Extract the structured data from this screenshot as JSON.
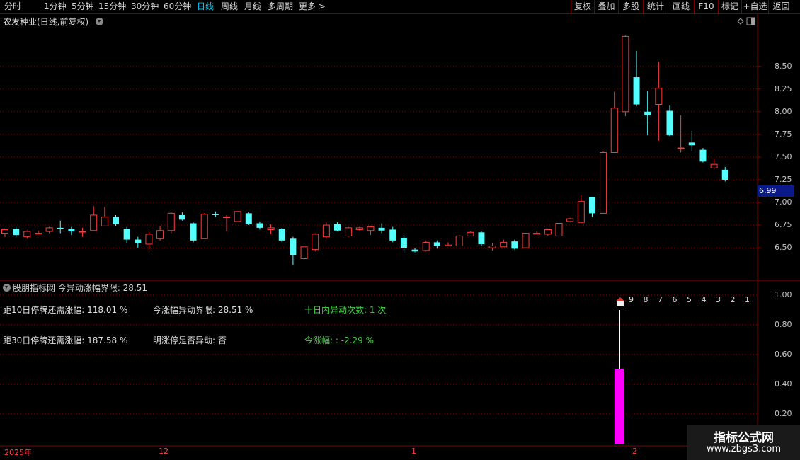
{
  "toolbar": {
    "periods": [
      "分时",
      "1分钟",
      "5分钟",
      "15分钟",
      "30分钟",
      "60分钟",
      "日线",
      "周线",
      "月线",
      "多周期",
      "更多 >"
    ],
    "active_period": "日线",
    "right_buttons": [
      "复权",
      "叠加",
      "多股",
      "统计",
      "画线",
      "F10",
      "标记",
      "+自选",
      "返回"
    ]
  },
  "main_panel": {
    "title": "农发种业(日线,前复权)",
    "current_price_badge": "6.99",
    "y_labels": [
      "8.50",
      "8.25",
      "8.00",
      "7.75",
      "7.50",
      "7.25",
      "7.00",
      "6.75",
      "6.50"
    ]
  },
  "indicator_panel": {
    "title": "股朋指标网 今异动涨幅界限: 28.51",
    "y_labels": [
      "1.00",
      "0.80",
      "0.60",
      "0.40",
      "0.20"
    ],
    "rows": [
      {
        "label": "距10日停牌还需涨幅:",
        "value": "118.01 %"
      },
      {
        "label": "今涨幅异动界限:",
        "value": "28.51 %"
      },
      {
        "label": "十日内异动次数:",
        "value": "1 次"
      },
      {
        "label": "距30日停牌还需涨幅:",
        "value": "187.58 %"
      },
      {
        "label": "明涨停是否异动:",
        "value": "否"
      },
      {
        "label": "今涨幅:",
        "value": ": -2.29 %"
      }
    ],
    "countdown": "9 8 7 6 5 4 3 2 1",
    "bar_value": 0.5,
    "line_top_value": 0.9
  },
  "date_axis": [
    "2025年",
    "12",
    "1",
    "2"
  ],
  "watermark": {
    "line1": "指标公式网",
    "line2": "www.zbgs3.com"
  },
  "colors": {
    "up": "#ff3c3c",
    "down": "#54ffff",
    "magenta": "#ff00ff",
    "grid": "#8a0000",
    "active": "#00c8ff"
  },
  "chart_data": {
    "type": "candlestick",
    "title": "农发种业(日线,前复权)",
    "ylim": [
      6.22,
      8.95
    ],
    "candles": [
      {
        "o": 6.66,
        "h": 6.71,
        "l": 6.62,
        "c": 6.7
      },
      {
        "o": 6.71,
        "h": 6.73,
        "l": 6.62,
        "c": 6.64
      },
      {
        "o": 6.62,
        "h": 6.69,
        "l": 6.6,
        "c": 6.68
      },
      {
        "o": 6.66,
        "h": 6.69,
        "l": 6.65,
        "c": 6.66
      },
      {
        "o": 6.68,
        "h": 6.73,
        "l": 6.66,
        "c": 6.72
      },
      {
        "o": 6.72,
        "h": 6.8,
        "l": 6.66,
        "c": 6.71
      },
      {
        "o": 6.71,
        "h": 6.73,
        "l": 6.64,
        "c": 6.68
      },
      {
        "o": 6.68,
        "h": 6.72,
        "l": 6.62,
        "c": 6.68
      },
      {
        "o": 6.69,
        "h": 6.96,
        "l": 6.69,
        "c": 6.86
      },
      {
        "o": 6.74,
        "h": 6.95,
        "l": 6.74,
        "c": 6.84
      },
      {
        "o": 6.84,
        "h": 6.86,
        "l": 6.74,
        "c": 6.76
      },
      {
        "o": 6.71,
        "h": 6.73,
        "l": 6.55,
        "c": 6.59
      },
      {
        "o": 6.59,
        "h": 6.62,
        "l": 6.5,
        "c": 6.55
      },
      {
        "o": 6.54,
        "h": 6.68,
        "l": 6.48,
        "c": 6.65
      },
      {
        "o": 6.6,
        "h": 6.74,
        "l": 6.58,
        "c": 6.69
      },
      {
        "o": 6.69,
        "h": 6.89,
        "l": 6.66,
        "c": 6.88
      },
      {
        "o": 6.86,
        "h": 6.89,
        "l": 6.8,
        "c": 6.81
      },
      {
        "o": 6.77,
        "h": 6.78,
        "l": 6.56,
        "c": 6.58
      },
      {
        "o": 6.6,
        "h": 6.88,
        "l": 6.6,
        "c": 6.87
      },
      {
        "o": 6.87,
        "h": 6.9,
        "l": 6.84,
        "c": 6.86
      },
      {
        "o": 6.84,
        "h": 6.86,
        "l": 6.68,
        "c": 6.84
      },
      {
        "o": 6.79,
        "h": 6.9,
        "l": 6.79,
        "c": 6.9
      },
      {
        "o": 6.88,
        "h": 6.89,
        "l": 6.75,
        "c": 6.76
      },
      {
        "o": 6.77,
        "h": 6.79,
        "l": 6.7,
        "c": 6.72
      },
      {
        "o": 6.7,
        "h": 6.76,
        "l": 6.65,
        "c": 6.72
      },
      {
        "o": 6.71,
        "h": 6.72,
        "l": 6.56,
        "c": 6.58
      },
      {
        "o": 6.6,
        "h": 6.62,
        "l": 6.31,
        "c": 6.42
      },
      {
        "o": 6.38,
        "h": 6.52,
        "l": 6.37,
        "c": 6.51
      },
      {
        "o": 6.48,
        "h": 6.66,
        "l": 6.46,
        "c": 6.65
      },
      {
        "o": 6.62,
        "h": 6.78,
        "l": 6.6,
        "c": 6.75
      },
      {
        "o": 6.76,
        "h": 6.78,
        "l": 6.68,
        "c": 6.69
      },
      {
        "o": 6.63,
        "h": 6.73,
        "l": 6.62,
        "c": 6.72
      },
      {
        "o": 6.7,
        "h": 6.73,
        "l": 6.69,
        "c": 6.72
      },
      {
        "o": 6.69,
        "h": 6.74,
        "l": 6.64,
        "c": 6.73
      },
      {
        "o": 6.72,
        "h": 6.77,
        "l": 6.66,
        "c": 6.69
      },
      {
        "o": 6.7,
        "h": 6.73,
        "l": 6.56,
        "c": 6.58
      },
      {
        "o": 6.61,
        "h": 6.64,
        "l": 6.46,
        "c": 6.5
      },
      {
        "o": 6.48,
        "h": 6.5,
        "l": 6.45,
        "c": 6.46
      },
      {
        "o": 6.47,
        "h": 6.58,
        "l": 6.46,
        "c": 6.56
      },
      {
        "o": 6.56,
        "h": 6.58,
        "l": 6.49,
        "c": 6.52
      },
      {
        "o": 6.52,
        "h": 6.56,
        "l": 6.52,
        "c": 6.53
      },
      {
        "o": 6.52,
        "h": 6.64,
        "l": 6.52,
        "c": 6.63
      },
      {
        "o": 6.63,
        "h": 6.68,
        "l": 6.63,
        "c": 6.67
      },
      {
        "o": 6.67,
        "h": 6.68,
        "l": 6.52,
        "c": 6.54
      },
      {
        "o": 6.5,
        "h": 6.55,
        "l": 6.47,
        "c": 6.52
      },
      {
        "o": 6.51,
        "h": 6.59,
        "l": 6.51,
        "c": 6.56
      },
      {
        "o": 6.57,
        "h": 6.59,
        "l": 6.48,
        "c": 6.49
      },
      {
        "o": 6.5,
        "h": 6.66,
        "l": 6.5,
        "c": 6.66
      },
      {
        "o": 6.65,
        "h": 6.68,
        "l": 6.65,
        "c": 6.66
      },
      {
        "o": 6.65,
        "h": 6.71,
        "l": 6.63,
        "c": 6.7
      },
      {
        "o": 6.63,
        "h": 6.75,
        "l": 6.63,
        "c": 6.77
      },
      {
        "o": 6.79,
        "h": 6.83,
        "l": 6.78,
        "c": 6.82
      },
      {
        "o": 6.78,
        "h": 7.08,
        "l": 6.78,
        "c": 7.01
      },
      {
        "o": 7.06,
        "h": 7.06,
        "l": 6.84,
        "c": 6.88
      },
      {
        "o": 6.88,
        "h": 7.56,
        "l": 6.88,
        "c": 7.55
      },
      {
        "o": 7.55,
        "h": 8.22,
        "l": 7.55,
        "c": 8.04
      },
      {
        "o": 8.0,
        "h": 8.84,
        "l": 7.95,
        "c": 8.83
      },
      {
        "o": 8.38,
        "h": 8.67,
        "l": 8.06,
        "c": 8.08
      },
      {
        "o": 8.0,
        "h": 8.23,
        "l": 7.74,
        "c": 7.96
      },
      {
        "o": 8.08,
        "h": 8.55,
        "l": 7.68,
        "c": 8.26
      },
      {
        "o": 8.01,
        "h": 8.07,
        "l": 7.73,
        "c": 7.74
      },
      {
        "o": 7.6,
        "h": 7.96,
        "l": 7.55,
        "c": 7.6
      },
      {
        "o": 7.66,
        "h": 7.79,
        "l": 7.56,
        "c": 7.63
      },
      {
        "o": 7.58,
        "h": 7.6,
        "l": 7.44,
        "c": 7.45
      },
      {
        "o": 7.38,
        "h": 7.48,
        "l": 7.37,
        "c": 7.42
      },
      {
        "o": 7.36,
        "h": 7.39,
        "l": 7.23,
        "c": 7.25
      }
    ]
  }
}
